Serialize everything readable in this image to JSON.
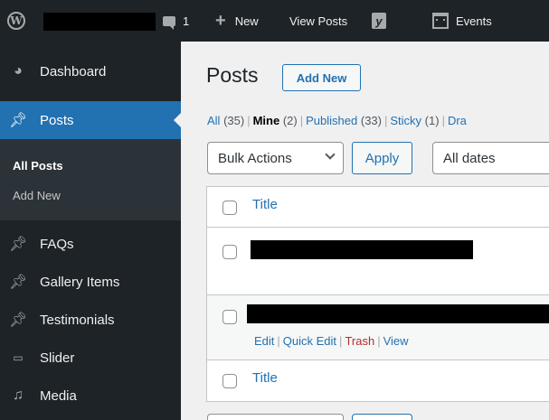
{
  "adminbar": {
    "comment_count": "1",
    "new_label": "New",
    "view_posts_label": "View Posts",
    "events_label": "Events",
    "yoast_glyph": "y"
  },
  "sidebar": {
    "items": [
      {
        "label": "Dashboard",
        "icon": "dashboard-icon"
      },
      {
        "label": "Posts",
        "icon": "pin-icon"
      },
      {
        "label": "FAQs",
        "icon": "pin-icon"
      },
      {
        "label": "Gallery Items",
        "icon": "pin-icon"
      },
      {
        "label": "Testimonials",
        "icon": "pin-icon"
      },
      {
        "label": "Slider",
        "icon": "slider-icon"
      },
      {
        "label": "Media",
        "icon": "media-icon"
      }
    ],
    "submenu": [
      {
        "label": "All Posts"
      },
      {
        "label": "Add New"
      }
    ]
  },
  "main": {
    "title": "Posts",
    "add_new": "Add New",
    "views": [
      {
        "label": "All",
        "count": "(35)"
      },
      {
        "label": "Mine",
        "count": "(2)"
      },
      {
        "label": "Published",
        "count": "(33)"
      },
      {
        "label": "Sticky",
        "count": "(1)"
      },
      {
        "label": "Dra",
        "count": ""
      }
    ],
    "bulk_actions": "Bulk Actions",
    "apply": "Apply",
    "dates": "All dates",
    "table": {
      "header_title": "Title",
      "footer_title": "Title",
      "row_actions": {
        "edit": "Edit",
        "quick_edit": "Quick Edit",
        "trash": "Trash",
        "view": "View"
      }
    }
  }
}
